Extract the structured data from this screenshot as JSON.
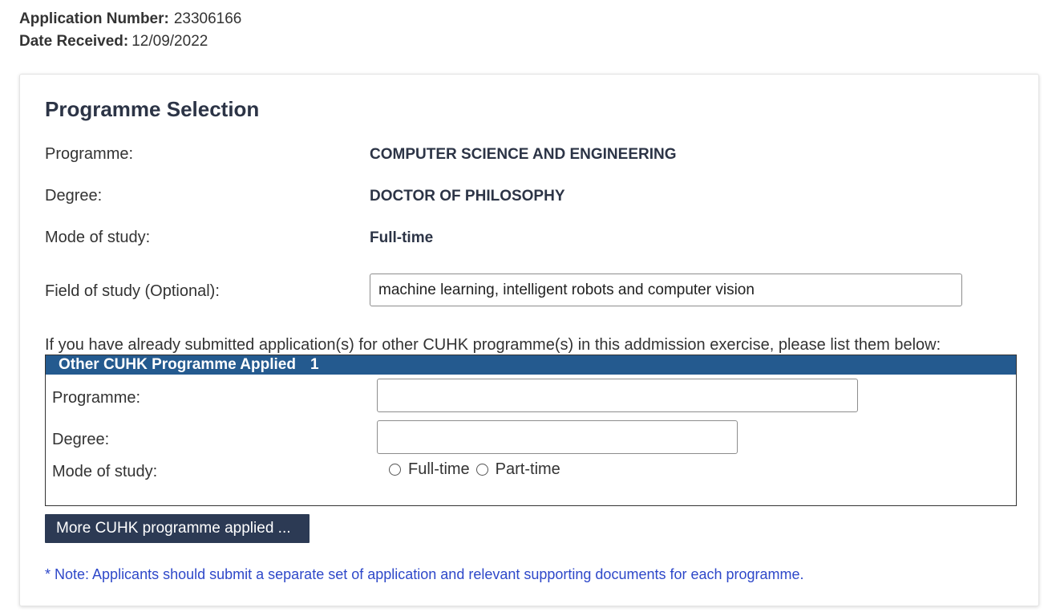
{
  "application": {
    "number_label": "Application Number:",
    "number_value": "23306166",
    "date_label": "Date Received:",
    "date_value": "12/09/2022"
  },
  "programme_selection": {
    "title": "Programme Selection",
    "programme_label": "Programme:",
    "programme_value": "COMPUTER SCIENCE AND ENGINEERING",
    "degree_label": "Degree:",
    "degree_value": "DOCTOR OF PHILOSOPHY",
    "mode_label": "Mode of study:",
    "mode_value": "Full-time",
    "field_label": "Field of study (Optional):",
    "field_value": "machine learning, intelligent robots and computer vision"
  },
  "other_programmes": {
    "intro": "If you have already submitted application(s) for other CUHK programme(s) in this addmission exercise, please list them below:",
    "header_label": "Other CUHK Programme Applied",
    "header_number": "1",
    "programme_label": "Programme:",
    "programme_value": "",
    "degree_label": "Degree:",
    "degree_value": "",
    "mode_label": "Mode of study:",
    "mode_options": [
      "Full-time",
      "Part-time"
    ],
    "more_button": "More CUHK programme applied ..."
  },
  "note": "* Note: Applicants should submit a separate set of application and relevant supporting documents for each programme.",
  "colors": {
    "header_blue": "#245a8f",
    "button_navy": "#2c3a54",
    "note_blue": "#2e48c9",
    "title_dark": "#2c3446"
  }
}
